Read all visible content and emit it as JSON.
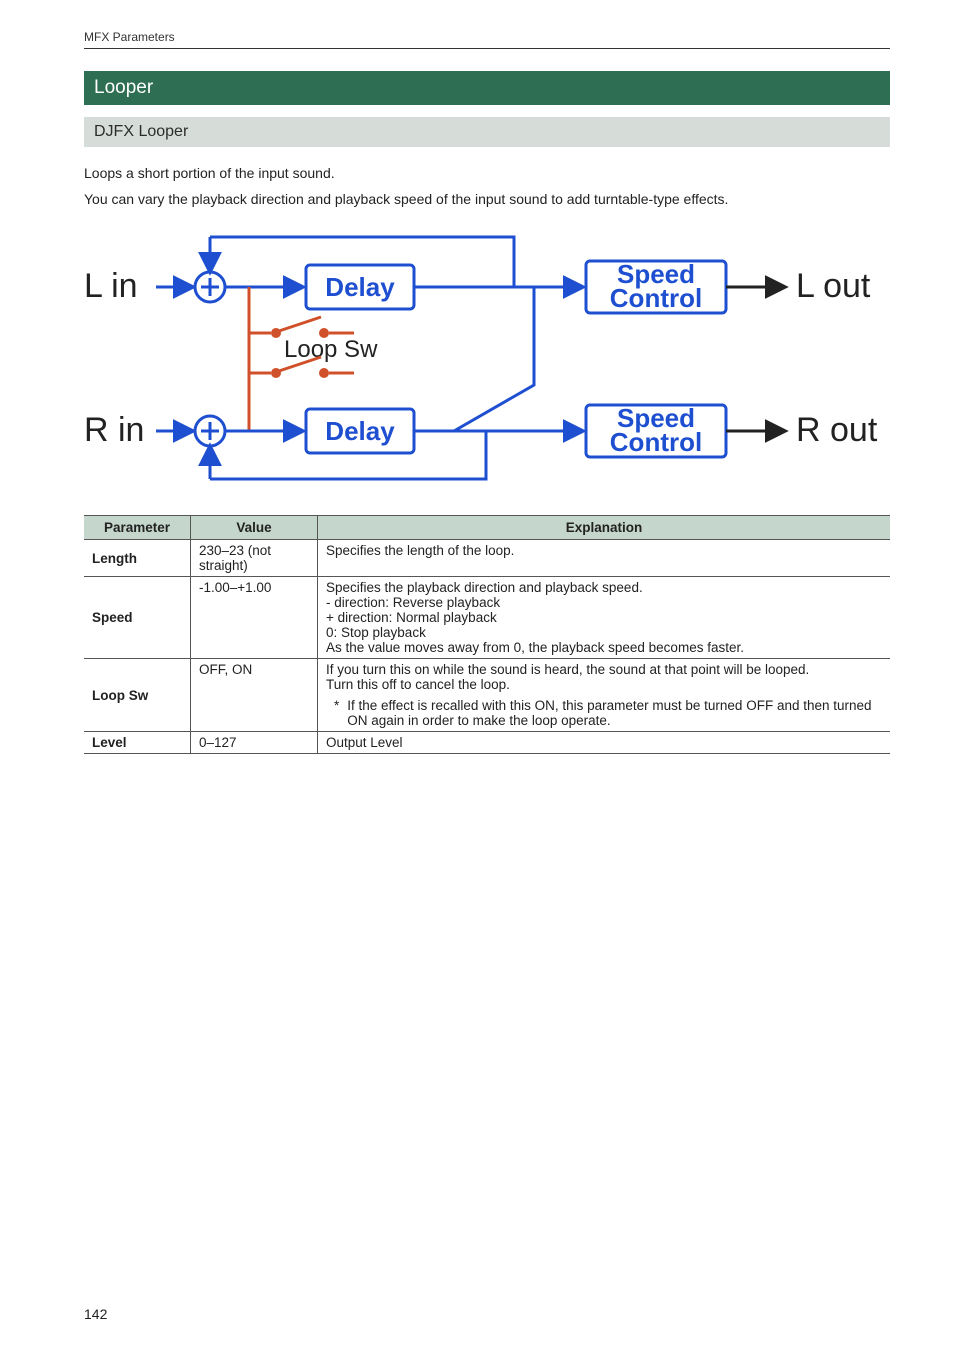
{
  "header": {
    "breadcrumb": "MFX Parameters"
  },
  "section": {
    "title": "Looper"
  },
  "subsection": {
    "title": "DJFX Looper"
  },
  "intro": {
    "p1": "Loops a short portion of the input sound.",
    "p2": "You can vary the playback direction and playback speed of the input sound to add turntable-type effects."
  },
  "diagram": {
    "l_in": "L in",
    "r_in": "R in",
    "l_out": "L out",
    "r_out": "R out",
    "delay": "Delay",
    "speed_control_1": "Speed",
    "speed_control_2": "Control",
    "loop_sw": "Loop Sw"
  },
  "table": {
    "headers": {
      "param": "Parameter",
      "value": "Value",
      "explanation": "Explanation"
    },
    "rows": {
      "length": {
        "param": "Length",
        "value": "230–23 (not straight)",
        "explanation": "Specifies the length of the loop."
      },
      "speed": {
        "param": "Speed",
        "value": "-1.00–+1.00",
        "exp_line1": "Specifies the playback direction and playback speed.",
        "exp_line2": "- direction: Reverse playback",
        "exp_line3": "+ direction: Normal playback",
        "exp_line4": "0: Stop playback",
        "exp_line5": "As the value moves away from 0, the playback speed becomes faster."
      },
      "loopsw": {
        "param": "Loop Sw",
        "value": "OFF, ON",
        "exp_line1": "If you turn this on while the sound is heard, the sound at that point will be looped.",
        "exp_line2": "Turn this off to cancel the loop.",
        "note_star": "*",
        "note": "If the effect is recalled with this ON, this parameter must be turned OFF and then turned ON again in order to make the loop operate."
      },
      "level": {
        "param": "Level",
        "value": "0–127",
        "explanation": "Output Level"
      }
    }
  },
  "page_number": "142"
}
